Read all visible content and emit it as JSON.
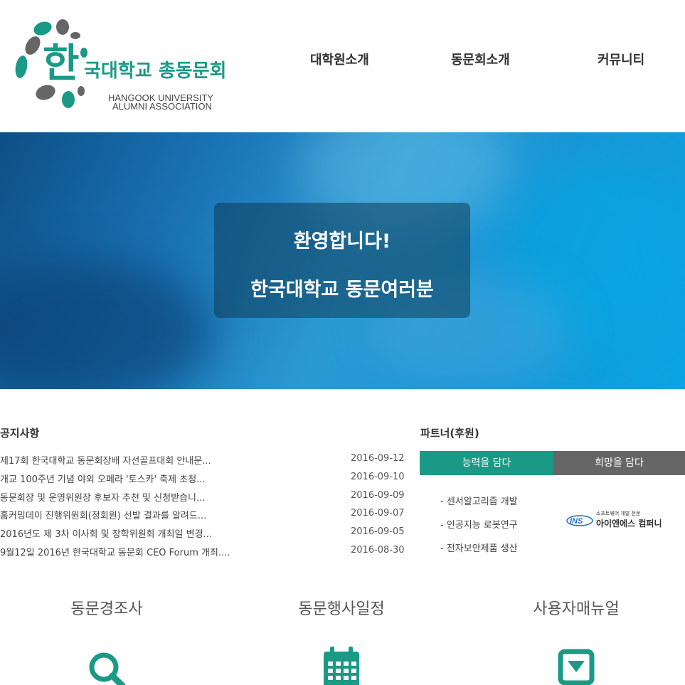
{
  "logo": {
    "hangul_big": "한",
    "hangul_rest": "국대학교 총동문회",
    "english_line1": "HANGOOK UNIVERSITY",
    "english_line2": "ALUMNI ASSOCIATION"
  },
  "nav": {
    "items": [
      {
        "label": "대학원소개"
      },
      {
        "label": "동문회소개"
      },
      {
        "label": "커뮤니티"
      }
    ]
  },
  "hero": {
    "line1": "환영합니다!",
    "line2": "한국대학교 동문여러분"
  },
  "notices": {
    "title": "공지사항",
    "items": [
      {
        "title": "제17회 한국대학교 동문회장배 자선골프대회 안내문...",
        "date": "2016-09-12"
      },
      {
        "title": "개교 100주년 기념 야외 오페라 '토스카' 축제 초청...",
        "date": "2016-09-10"
      },
      {
        "title": "동문회장 및 운영위원장 후보자 추천 및 신청받습니...",
        "date": "2016-09-09"
      },
      {
        "title": "홈커밍데이 진행위원회(정회원) 선발 결과를 알려드...",
        "date": "2016-09-07"
      },
      {
        "title": "2016년도 제 3차 이사회 및 장학위원회 개최일 변경...",
        "date": "2016-09-05"
      },
      {
        "title": "9월12일 2016년 한국대학교 동문회 CEO Forum 개최....",
        "date": "2016-08-30"
      }
    ]
  },
  "partners": {
    "title": "파트너(후원)",
    "tabs": [
      {
        "label": "능력을 담다"
      },
      {
        "label": "희망을 담다"
      }
    ],
    "items": [
      {
        "label": "- 센서알고리즘 개발"
      },
      {
        "label": "- 인공지능 로봇연구"
      },
      {
        "label": "- 전자보안제품 생산"
      }
    ],
    "company": {
      "badge": "INS",
      "tagline": "소프트웨어 개발 전문",
      "name": "아이엔에스 컴퍼니"
    }
  },
  "quick_links": [
    {
      "label": "동문경조사",
      "icon": "search-icon"
    },
    {
      "label": "동문행사일정",
      "icon": "calendar-icon"
    },
    {
      "label": "사용자매뉴얼",
      "icon": "download-icon"
    }
  ],
  "colors": {
    "accent": "#1a9a86",
    "secondary": "#666666",
    "logo_gray": "#666666"
  }
}
